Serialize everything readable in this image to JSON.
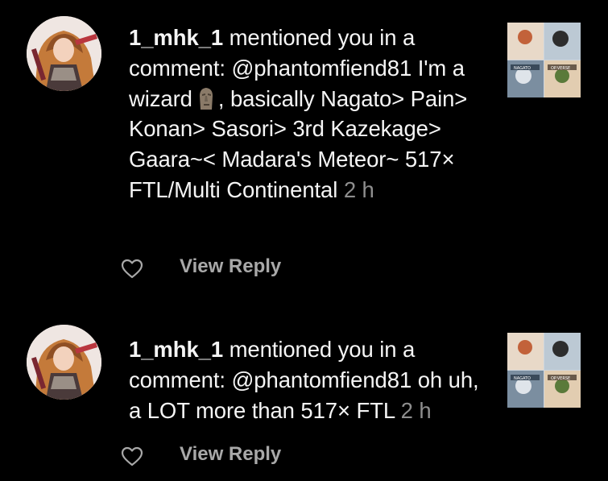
{
  "notifications": [
    {
      "username": "1_mhk_1",
      "action_text": "mentioned you in a comment:",
      "mention": "@phantomfiend81",
      "text_before_emoji": "I'm a wizard",
      "emoji_name": "moai-icon",
      "text_after_emoji": ", basically Nagato> Pain> Konan> Sasori> 3rd Kazekage> Gaara~< Madara's Meteor~ 517× FTL/Multi Continental",
      "timestamp": "2 h",
      "reply_label": "View Reply"
    },
    {
      "username": "1_mhk_1",
      "action_text": "mentioned you in a comment:",
      "mention": "@phantomfiend81",
      "text": "oh uh, a LOT more than 517× FTL",
      "timestamp": "2 h",
      "reply_label": "View Reply"
    }
  ],
  "colors": {
    "background": "#000000",
    "text": "#f5f5f5",
    "timestamp": "#8e8e8e",
    "reply": "#a8a8a8"
  }
}
